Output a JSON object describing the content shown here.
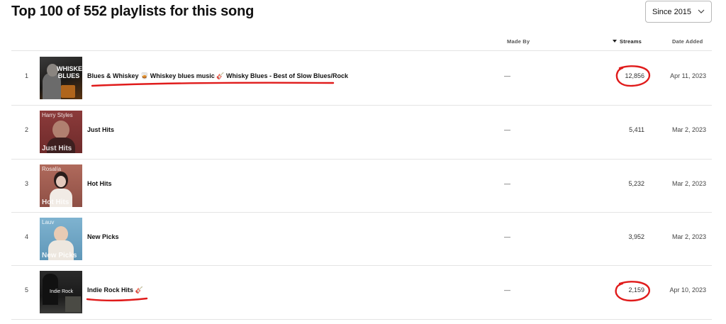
{
  "page_title": "Top 100 of 552 playlists for this song",
  "filter": {
    "selected": "Since 2015"
  },
  "columns": {
    "made_by": "Made By",
    "streams": "Streams",
    "date_added": "Date Added"
  },
  "rows": [
    {
      "rank": "1",
      "name": "Blues & Whiskey 🥃 Whiskey blues music 🎸 Whisky Blues - Best of Slow Blues/Rock",
      "made_by": "—",
      "streams": "12,856",
      "date_added": "Apr 11, 2023",
      "cover_text": "WHISKEY BLUES"
    },
    {
      "rank": "2",
      "name": "Just Hits",
      "made_by": "—",
      "streams": "5,411",
      "date_added": "Mar 2, 2023",
      "cover_text": "Harry Styles",
      "cover_text2": "Just Hits"
    },
    {
      "rank": "3",
      "name": "Hot Hits",
      "made_by": "—",
      "streams": "5,232",
      "date_added": "Mar 2, 2023",
      "cover_text": "Rosalía",
      "cover_text2": "Hot Hits"
    },
    {
      "rank": "4",
      "name": "New Picks",
      "made_by": "—",
      "streams": "3,952",
      "date_added": "Mar 2, 2023",
      "cover_text": "Lauv",
      "cover_text2": "New Picks"
    },
    {
      "rank": "5",
      "name": "Indie Rock Hits 🎸",
      "made_by": "—",
      "streams": "2,159",
      "date_added": "Apr 10, 2023",
      "cover_text": "Indie Rock"
    }
  ],
  "colors": {
    "annotation": "#e01b1b",
    "divider": "#e4e4e4"
  }
}
